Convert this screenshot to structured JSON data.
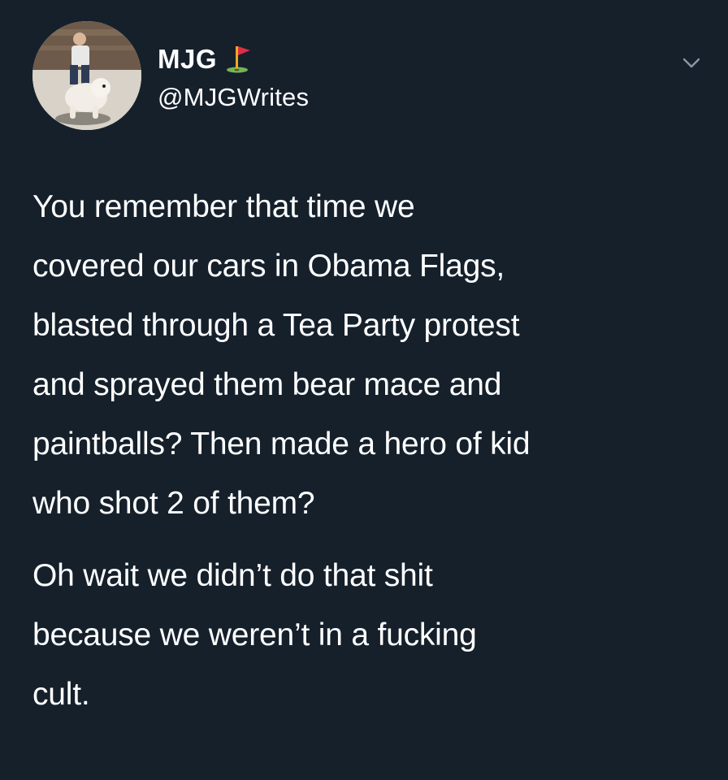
{
  "colors": {
    "background": "#15202b",
    "text": "#ffffff",
    "muted": "#8899a6"
  },
  "user": {
    "display_name": "MJG",
    "name_emoji_icon": "golf-flag-icon",
    "handle": "@MJGWrites",
    "avatar_icon": "avatar-photo"
  },
  "menu": {
    "icon": "chevron-down-icon"
  },
  "tweet": {
    "paragraphs": [
      "You remember that time we\ncovered our cars in Obama Flags,\nblasted through a Tea Party protest\nand sprayed them bear mace and\npaintballs? Then made a hero of kid\nwho shot 2 of them?",
      "Oh wait we didn’t do that shit\nbecause we weren’t in a fucking\ncult."
    ]
  }
}
